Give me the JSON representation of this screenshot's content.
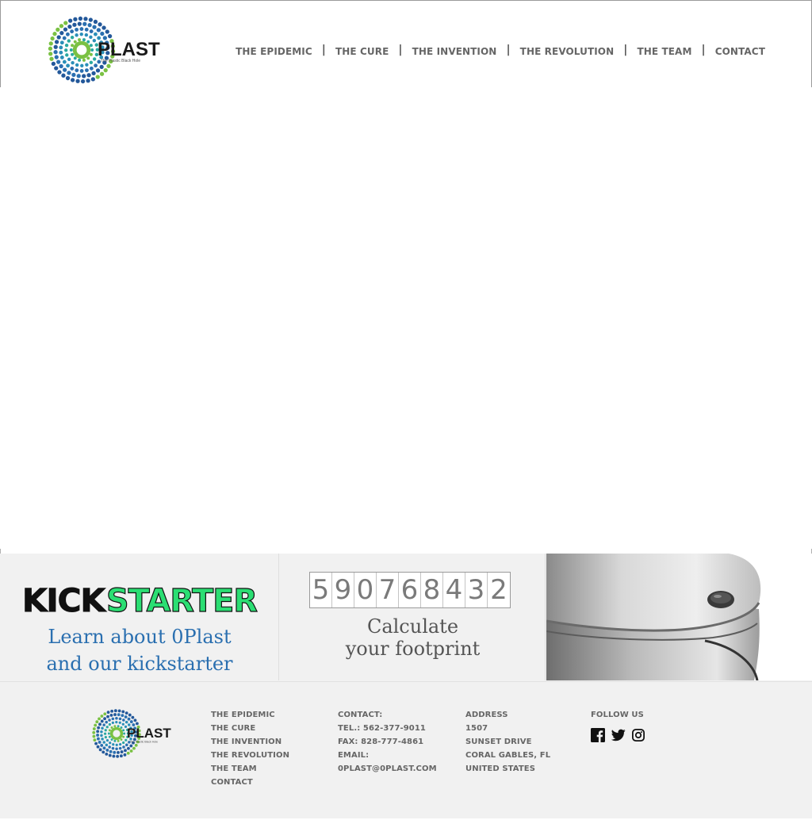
{
  "brand": {
    "name": "0PLAST",
    "tagline": "The Plastic Black Hole",
    "primary_green": "#7ac143",
    "primary_blue": "#2a6fb0",
    "teal": "#2aa8a0"
  },
  "nav": {
    "items": [
      {
        "label": "THE EPIDEMIC"
      },
      {
        "label": "THE CURE"
      },
      {
        "label": "THE INVENTION"
      },
      {
        "label": "THE REVOLUTION"
      },
      {
        "label": "THE TEAM"
      },
      {
        "label": "CONTACT"
      }
    ],
    "separator": "|"
  },
  "promo": {
    "kickstarter": {
      "logo_text": "KICKSTARTER",
      "logo_colors": {
        "kick": "#111111",
        "starter": "#2bde73",
        "outline": "#111111"
      },
      "line1": "Learn about 0Plast",
      "line2": "and our kickstarter"
    },
    "calculator": {
      "digits": [
        "5",
        "9",
        "0",
        "7",
        "6",
        "8",
        "4",
        "3",
        "2"
      ],
      "line1": "Calculate",
      "line2": "your footprint"
    },
    "product_image": "product-photo"
  },
  "footer": {
    "nav": [
      "THE EPIDEMIC",
      "THE CURE",
      "THE INVENTION",
      "THE REVOLUTION",
      "THE TEAM",
      "CONTACT"
    ],
    "contact": {
      "heading": "CONTACT:",
      "tel": "TEL.: 562-377-9011",
      "fax": "FAX: 828-777-4861",
      "email_label": "EMAIL:",
      "email": "0PLAST@0PLAST.COM"
    },
    "address": {
      "heading": "ADDRESS",
      "lines": [
        "1507",
        "SUNSET DRIVE",
        "CORAL GABLES, FL",
        "UNITED STATES"
      ]
    },
    "follow": {
      "heading": "FOLLOW US",
      "icons": [
        "facebook-icon",
        "twitter-icon",
        "instagram-icon"
      ]
    }
  }
}
